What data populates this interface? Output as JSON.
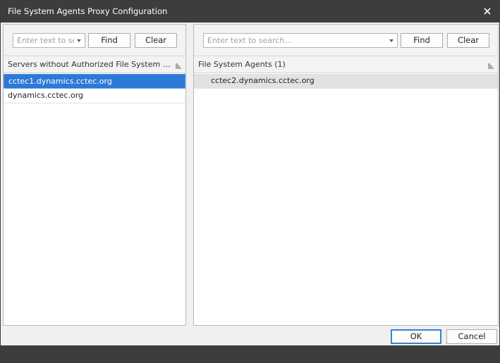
{
  "window": {
    "title": "File System Agents Proxy Configuration",
    "close_icon": "close-icon"
  },
  "left_panel": {
    "search": {
      "placeholder": "Enter text to search...",
      "value": ""
    },
    "find_label": "Find",
    "clear_label": "Clear",
    "header": "Servers without Authorized File System Agents",
    "items": [
      {
        "label": "cctec1.dynamics.cctec.org",
        "selected": true
      },
      {
        "label": "dynamics.cctec.org",
        "selected": false
      }
    ]
  },
  "right_panel": {
    "search": {
      "placeholder": "Enter text to search...",
      "value": ""
    },
    "find_label": "Find",
    "clear_label": "Clear",
    "header": "File System Agents (1)",
    "items": [
      {
        "label": "cctec2.dynamics.cctec.org"
      }
    ]
  },
  "dialog_buttons": {
    "ok_label": "OK",
    "cancel_label": "Cancel"
  },
  "colors": {
    "titlebar": "#3d3d3d",
    "selection": "#2b79d8",
    "default_button_border": "#3a7fd1"
  }
}
